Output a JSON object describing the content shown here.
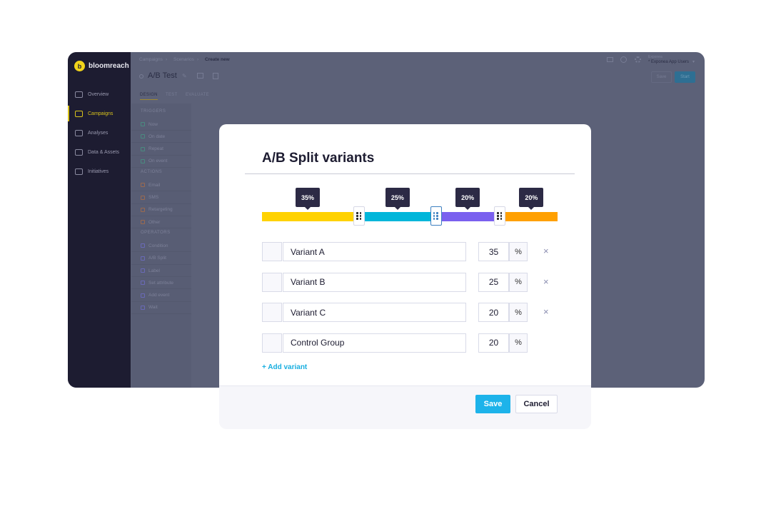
{
  "app": {
    "brand": "bloomreach",
    "sidebar": [
      {
        "label": "Overview",
        "icon": "dashboard-icon",
        "active": false
      },
      {
        "label": "Campaigns",
        "icon": "megaphone-icon",
        "active": true
      },
      {
        "label": "Analyses",
        "icon": "pie-chart-icon",
        "active": false
      },
      {
        "label": "Data & Assets",
        "icon": "database-icon",
        "active": false
      },
      {
        "label": "Initiatives",
        "icon": "folder-icon",
        "active": false
      }
    ],
    "breadcrumb": [
      "Campaigns",
      "Scenarios",
      "Create new"
    ],
    "title": "A/B Test",
    "tabs": [
      {
        "label": "DESIGN",
        "active": true
      },
      {
        "label": "TEST"
      },
      {
        "label": "EVALUATE"
      }
    ],
    "project_label": "Exponea",
    "project_value": "* Exponea App Users",
    "header_save": "Save",
    "header_start": "Start",
    "palette": [
      {
        "section": "TRIGGERS",
        "items": [
          {
            "label": "Now",
            "color": "#4a8a80"
          },
          {
            "label": "On date",
            "color": "#4a8a80"
          },
          {
            "label": "Repeat",
            "color": "#4a8a80"
          },
          {
            "label": "On event",
            "color": "#4a8a80"
          }
        ]
      },
      {
        "section": "ACTIONS",
        "items": [
          {
            "label": "Email",
            "color": "#9a6a50"
          },
          {
            "label": "SMS",
            "color": "#9a6a50"
          },
          {
            "label": "Retargeting",
            "color": "#9a6a50"
          },
          {
            "label": "Other",
            "color": "#9a6a50"
          }
        ]
      },
      {
        "section": "OPERATORS",
        "items": [
          {
            "label": "Condition",
            "color": "#6a6ab8"
          },
          {
            "label": "A/B Split",
            "color": "#6a6ab8"
          },
          {
            "label": "Label",
            "color": "#6a6ab8"
          },
          {
            "label": "Set attribute",
            "color": "#6a6ab8"
          },
          {
            "label": "Add event",
            "color": "#6a6ab8"
          },
          {
            "label": "Wait",
            "color": "#6a6ab8"
          }
        ]
      }
    ]
  },
  "modal": {
    "title": "A/B Split variants",
    "variants": [
      {
        "name": "Variant A",
        "percent": 35,
        "percent_label": "35%",
        "color": "#ffd200",
        "removable": true
      },
      {
        "name": "Variant B",
        "percent": 25,
        "percent_label": "25%",
        "color": "#00b6da",
        "removable": true
      },
      {
        "name": "Variant C",
        "percent": 20,
        "percent_label": "20%",
        "color": "#7a60ef",
        "removable": true
      },
      {
        "name": "Control Group",
        "percent": 20,
        "percent_label": "20%",
        "color": "#ffa000",
        "removable": false
      }
    ],
    "unit": "%",
    "remove_glyph": "×",
    "add_variant": "+ Add variant",
    "save": "Save",
    "cancel": "Cancel"
  }
}
